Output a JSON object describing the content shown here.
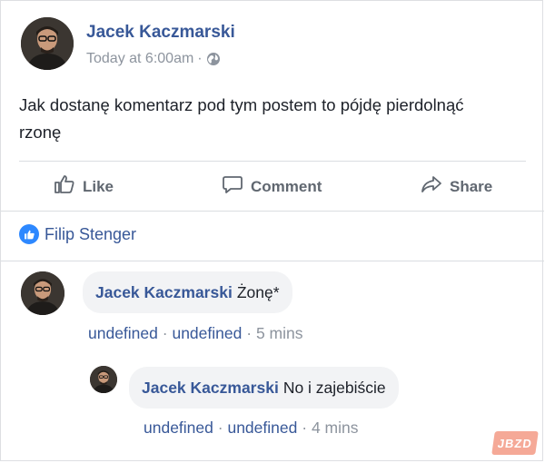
{
  "post": {
    "author": "Jacek Kaczmarski",
    "time": "Today at 6:00am",
    "separator": "·",
    "text": "Jak dostanę komentarz pod tym postem to pójdę pierdolnąć rzonę"
  },
  "actions": {
    "like": "Like",
    "comment": "Comment",
    "share": "Share"
  },
  "reactions": {
    "liked_by": "Filip Stenger"
  },
  "comments": [
    {
      "author": "Jacek Kaczmarski",
      "text": "Żonę*",
      "action1": "undefined",
      "action2": "undefined",
      "sep": "·",
      "time": "5 mins"
    },
    {
      "author": "Jacek Kaczmarski",
      "text": "No i zajebiście",
      "action1": "undefined",
      "action2": "undefined",
      "sep": "·",
      "time": "4 mins"
    }
  ],
  "watermark": "JBZD",
  "colors": {
    "link": "#385898",
    "muted": "#8d949e",
    "like_blue": "#2d88ff"
  }
}
